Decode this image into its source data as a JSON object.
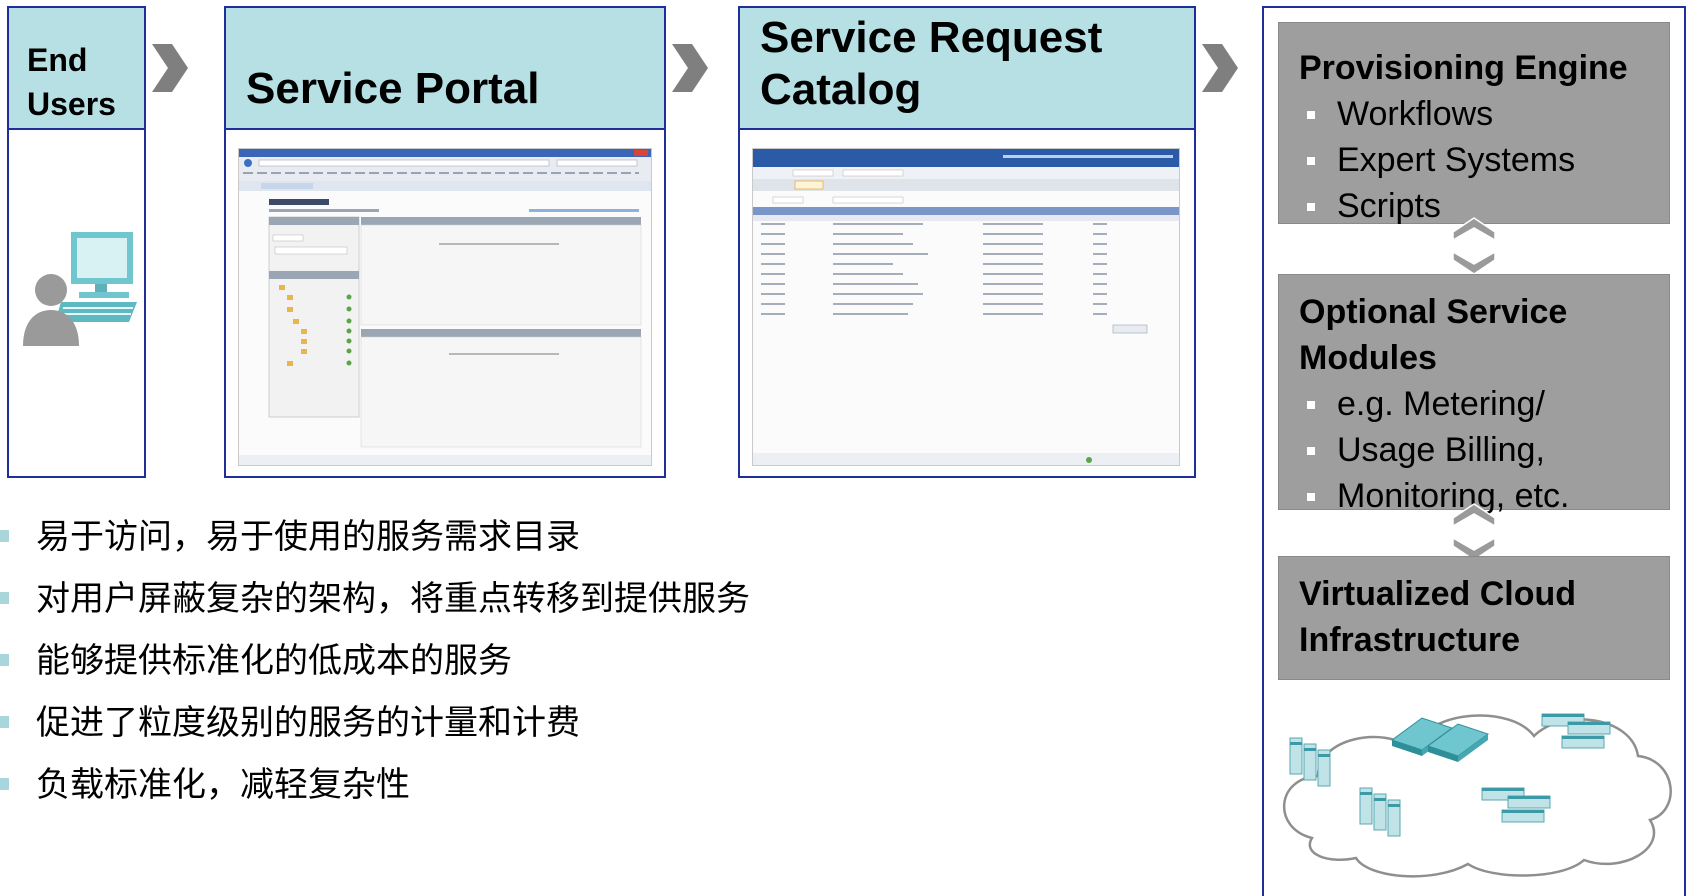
{
  "panels": {
    "end_users": {
      "line1": "End",
      "line2": "Users"
    },
    "portal": {
      "title": "Service Portal"
    },
    "catalog": {
      "line1": "Service Request",
      "line2": "Catalog"
    }
  },
  "right": {
    "provisioning": {
      "title": "Provisioning Engine",
      "items": [
        "Workflows",
        "Expert Systems",
        "Scripts"
      ]
    },
    "optional": {
      "line1": "Optional Service",
      "line2": "Modules",
      "items": [
        "e.g. Metering/",
        "Usage Billing,",
        "Monitoring, etc."
      ]
    },
    "virtualized": {
      "line1": "Virtualized Cloud",
      "line2": "Infrastructure"
    }
  },
  "bullets": [
    "易于访问，易于使用的服务需求目录",
    "对用户屏蔽复杂的架构，将重点转移到提供服务",
    "能够提供标准化的低成本的服务",
    "促进了粒度级别的服务的计量和计费",
    "负载标准化，减轻复杂性"
  ],
  "colors": {
    "header_fill": "#b7e0e4",
    "border": "#1f2f9a",
    "engine_fill": "#9e9e9e",
    "chevron": "#7f7f7f",
    "bullet": "#a9d6da"
  },
  "icons": [
    "user-at-computer-icon",
    "chevron-right-icon",
    "double-arrow-icon",
    "cloud-servers-icon"
  ]
}
